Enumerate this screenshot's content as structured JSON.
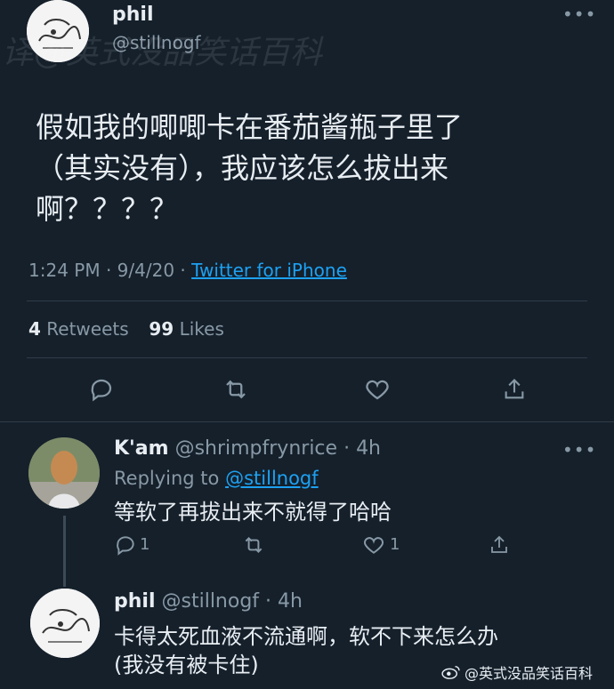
{
  "main_tweet": {
    "name": "phil",
    "handle": "@stillnogf",
    "text_lines": [
      "假如我的唧唧卡在番茄酱瓶子里了",
      "（其实没有），我应该怎么拔出来",
      "啊？？？？"
    ],
    "time": "1:24 PM",
    "date": "9/4/20",
    "source": "Twitter for iPhone",
    "retweets_count": "4",
    "retweets_label": "Retweets",
    "likes_count": "99",
    "likes_label": "Likes",
    "overflow_icon": "more-dots-icon"
  },
  "reply1": {
    "name": "K'am",
    "handle": "@shrimpfrynrice",
    "age": "4h",
    "replying_prefix": "Replying to",
    "replying_handle": "@stillnogf",
    "text": "等软了再拔出来不就得了哈哈",
    "reply_count": "1",
    "like_count": "1"
  },
  "reply2": {
    "name": "phil",
    "handle": "@stillnogf",
    "age": "4h",
    "text_lines": [
      "卡得太死血液不流通啊，软不下来怎么办",
      "(我没有被卡住)"
    ]
  },
  "watermark_top": "译@英式没品笑话百科",
  "watermark_bottom": "@英式没品笑话百科",
  "colors": {
    "background": "#15202b",
    "text": "#e8edf2",
    "muted": "#8899a6",
    "link": "#1da1f2",
    "divider": "#2f3c49"
  }
}
